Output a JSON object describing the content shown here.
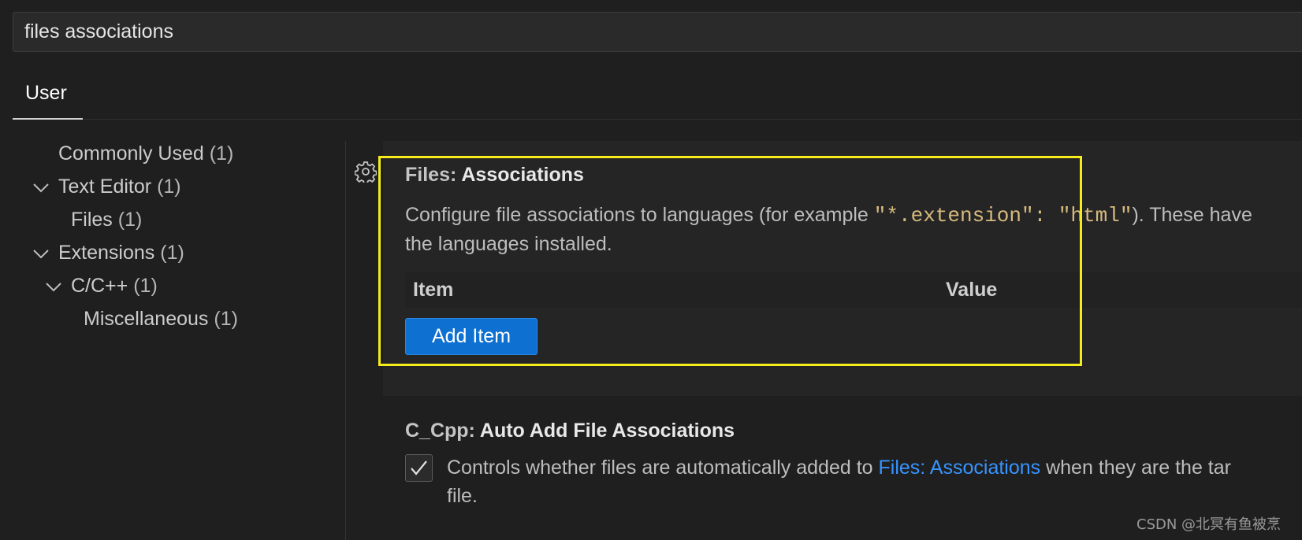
{
  "search": {
    "value": "files associations"
  },
  "tabs": [
    {
      "label": "User"
    }
  ],
  "tree": [
    {
      "label": "Commonly Used",
      "count": "(1)",
      "expanded": null
    },
    {
      "label": "Text Editor",
      "count": "(1)",
      "expanded": true
    },
    {
      "label": "Files",
      "count": "(1)",
      "expanded": null
    },
    {
      "label": "Extensions",
      "count": "(1)",
      "expanded": true
    },
    {
      "label": "C/C++",
      "count": "(1)",
      "expanded": true
    },
    {
      "label": "Miscellaneous",
      "count": "(1)",
      "expanded": null
    }
  ],
  "setting1": {
    "category": "Files: ",
    "name": "Associations",
    "desc_part1": "Configure file associations to languages (for example ",
    "code1": "\"*.extension\": \"html\"",
    "desc_part2": "). These have",
    "desc_line2": "the languages installed.",
    "col_item": "Item",
    "col_value": "Value",
    "add_button": "Add Item"
  },
  "setting2": {
    "category": "C_Cpp: ",
    "name": "Auto Add File Associations",
    "checked": true,
    "desc_part1": "Controls whether files are automatically added to ",
    "link": "Files: Associations",
    "desc_part2": " when they are the tar",
    "desc_line2": "file."
  },
  "watermark": "CSDN @北冥有鱼被烹",
  "colors": {
    "background": "#1f1f1f",
    "button": "#0e70d1",
    "highlight": "#f5ed1b",
    "link": "#3794ff",
    "code": "#d7ba7d"
  },
  "icons": [
    "gear-icon",
    "chevron-down-icon",
    "checkmark-icon"
  ]
}
